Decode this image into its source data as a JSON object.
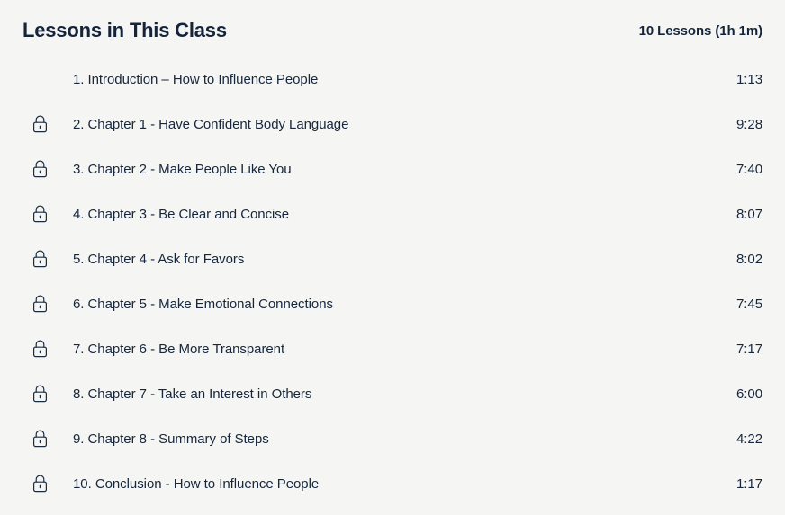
{
  "header": {
    "title": "Lessons in This Class",
    "count_label": "10 Lessons (1h 1m)"
  },
  "colors": {
    "background": "#f5f5f4",
    "text": "#16263c",
    "heading": "#14243a",
    "lock_stroke": "#1b2b3f"
  },
  "icons": {
    "lock": "lock-icon"
  },
  "lessons": [
    {
      "index": "1.",
      "title": "Introduction – How to Influence People",
      "duration": "1:13",
      "locked": false
    },
    {
      "index": "2.",
      "title": "Chapter 1 - Have Confident Body Language",
      "duration": "9:28",
      "locked": true
    },
    {
      "index": "3.",
      "title": "Chapter 2 - Make People Like You",
      "duration": "7:40",
      "locked": true
    },
    {
      "index": "4.",
      "title": "Chapter 3 - Be Clear and Concise",
      "duration": "8:07",
      "locked": true
    },
    {
      "index": "5.",
      "title": "Chapter 4 - Ask for Favors",
      "duration": "8:02",
      "locked": true
    },
    {
      "index": "6.",
      "title": "Chapter 5 - Make Emotional Connections",
      "duration": "7:45",
      "locked": true
    },
    {
      "index": "7.",
      "title": "Chapter 6 - Be More Transparent",
      "duration": "7:17",
      "locked": true
    },
    {
      "index": "8.",
      "title": "Chapter 7 - Take an Interest in Others",
      "duration": "6:00",
      "locked": true
    },
    {
      "index": "9.",
      "title": "Chapter 8 - Summary of Steps",
      "duration": "4:22",
      "locked": true
    },
    {
      "index": "10.",
      "title": "Conclusion - How to Influence People",
      "duration": "1:17",
      "locked": true
    }
  ]
}
